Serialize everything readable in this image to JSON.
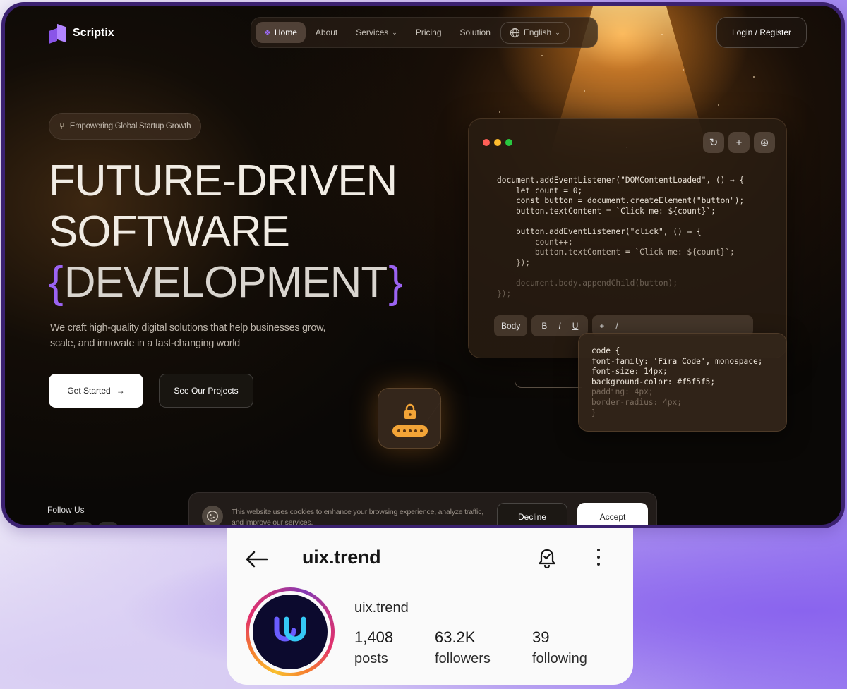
{
  "site": {
    "logo_text": "Scriptix",
    "nav": {
      "home": "Home",
      "about": "About",
      "services": "Services",
      "pricing": "Pricing",
      "solution": "Solution",
      "language": "English"
    },
    "login_label": "Login / Register",
    "badge": "Empowering Global Startup Growth",
    "hero": {
      "line1": "FUTURE-DRIVEN",
      "line2": "SOFTWARE",
      "brace_open": "{",
      "line3": "DEVELOPMENT",
      "brace_close": "}",
      "subtitle": "We craft high-quality digital solutions that help businesses grow, scale, and innovate in a fast-changing world"
    },
    "cta_primary": "Get Started",
    "cta_secondary": "See Our Projects",
    "follow_label": "Follow Us",
    "code_window": {
      "code_lines": [
        "document.addEventListener(\"DOMContentLoaded\", () ⇒ {",
        "    let count = 0;",
        "    const button = document.createElement(\"button\");",
        "    button.textContent = `Click me: ${count}`;",
        "",
        "    button.addEventListener(\"click\", () ⇒ {",
        "        count++;",
        "        button.textContent = `Click me: ${count}`;",
        "    });",
        "",
        "    document.body.appendChild(button);",
        "});"
      ],
      "toolbar": {
        "body": "Body",
        "bold": "B",
        "italic": "I",
        "underline": "U",
        "plus": "+",
        "slash": "/"
      }
    },
    "css_card_lines": [
      "code {",
      "font-family: 'Fira Code', monospace;",
      "font-size: 14px;",
      "background-color: #f5f5f5;",
      "padding: 4px;",
      "border-radius: 4px;",
      "}"
    ],
    "cookie": {
      "text": "This website uses cookies to enhance your browsing experience, analyze traffic, and improve our services.",
      "decline": "Decline",
      "accept": "Accept"
    },
    "colors": {
      "accent": "#9b63f2",
      "lock_accent": "#f2a437"
    }
  },
  "instagram": {
    "handle": "uix.trend",
    "name": "uix.trend",
    "stats": {
      "posts_value": "1,408",
      "posts_label": "posts",
      "followers_value": "63.2K",
      "followers_label": "followers",
      "following_value": "39",
      "following_label": "following"
    },
    "icons": {
      "back": "arrow-left-icon",
      "bell": "bell-check-icon",
      "more": "more-vertical-icon"
    }
  }
}
